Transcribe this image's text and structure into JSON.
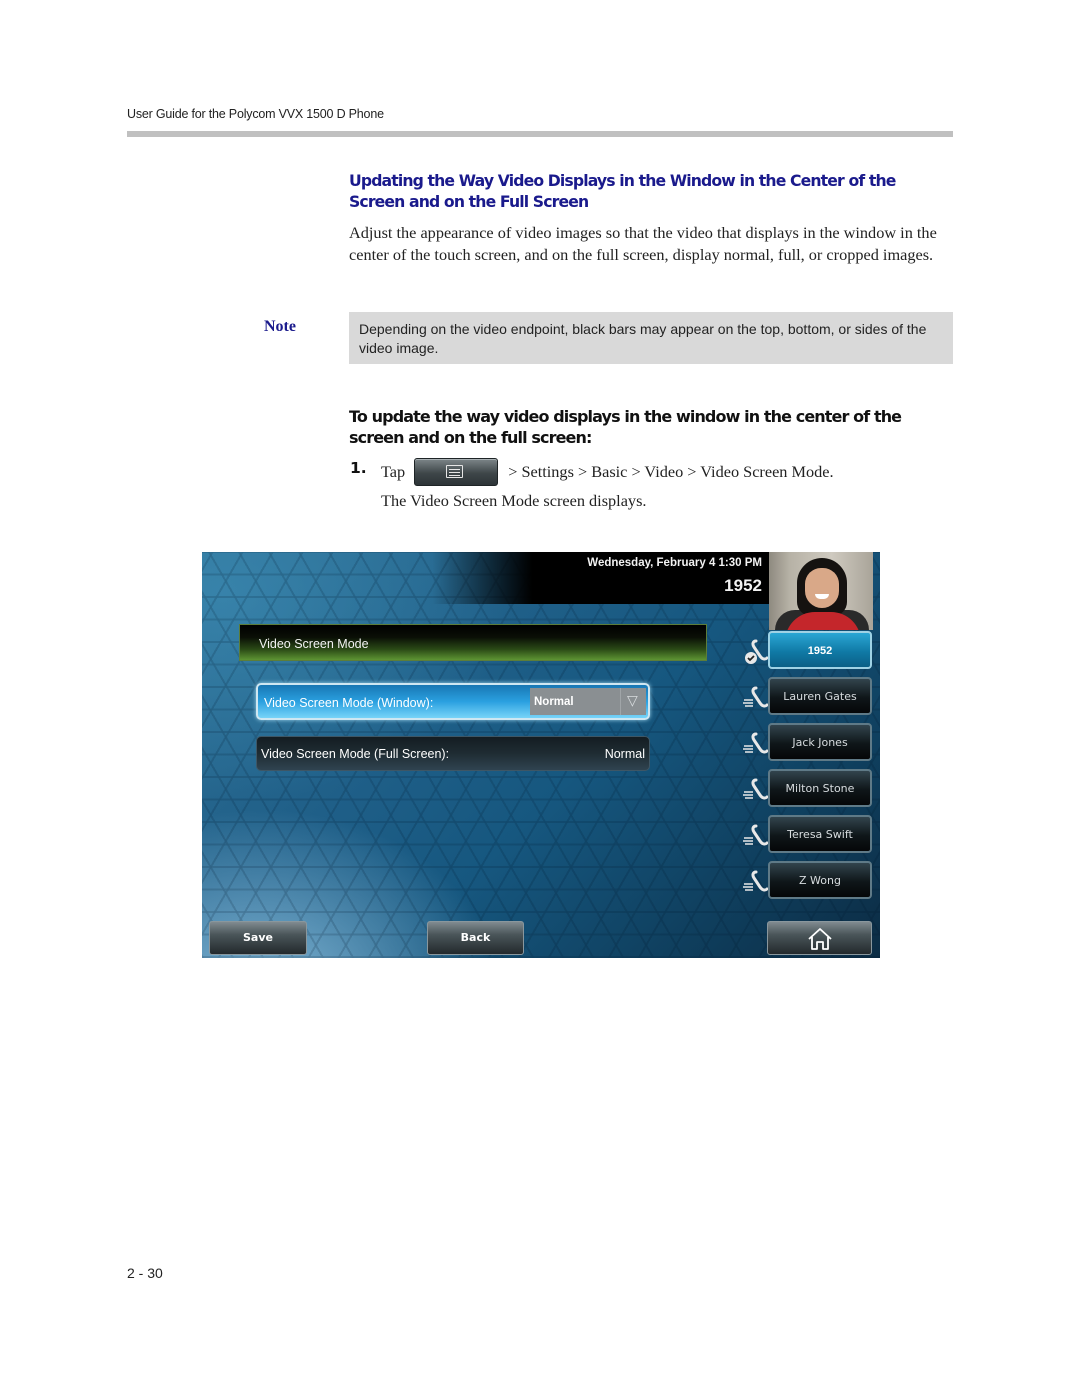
{
  "header": {
    "title": "User Guide for the Polycom VVX 1500 D Phone"
  },
  "section": {
    "title": "Updating the Way Video Displays in the Window in the Center of the Screen and on the Full Screen",
    "intro": "Adjust the appearance of video images so that the video that displays in the window in the center of the touch screen, and on the full screen, display normal, full, or cropped images."
  },
  "note": {
    "label": "Note",
    "text": "Depending on the video endpoint, black bars may appear on the top, bottom, or sides of the video image."
  },
  "procedure": {
    "title": "To update the way video displays in the window in the center of the screen and on the full screen:",
    "steps": [
      {
        "number": "1.",
        "prefix": "Tap",
        "button_icon": "menu-icon",
        "path": "> Settings > Basic > Video > Video Screen Mode",
        "suffix": ".",
        "result": "The Video Screen Mode screen displays."
      }
    ]
  },
  "phone_screen": {
    "datetime": "Wednesday, February 4  1:30 PM",
    "extension": "1952",
    "screen_title": "Video Screen Mode",
    "settings": [
      {
        "label": "Video Screen Mode (Window):",
        "value": "Normal",
        "selected": true,
        "control": "dropdown"
      },
      {
        "label": "Video Screen Mode (Full Screen):",
        "value": "Normal",
        "selected": false,
        "control": "text"
      }
    ],
    "lines": [
      {
        "label": "1952",
        "icon": "phone-registered-icon",
        "active": true
      },
      {
        "label": "Lauren Gates",
        "icon": "speed-dial-phone-icon",
        "active": false
      },
      {
        "label": "Jack Jones",
        "icon": "speed-dial-phone-icon",
        "active": false
      },
      {
        "label": "Milton Stone",
        "icon": "speed-dial-phone-icon",
        "active": false
      },
      {
        "label": "Teresa Swift",
        "icon": "speed-dial-phone-icon",
        "active": false
      },
      {
        "label": "Z Wong",
        "icon": "speed-dial-phone-icon",
        "active": false
      }
    ],
    "buttons": {
      "save": "Save",
      "back": "Back",
      "home_icon": "home-icon"
    }
  },
  "footer": {
    "page_number": "2 - 30"
  }
}
